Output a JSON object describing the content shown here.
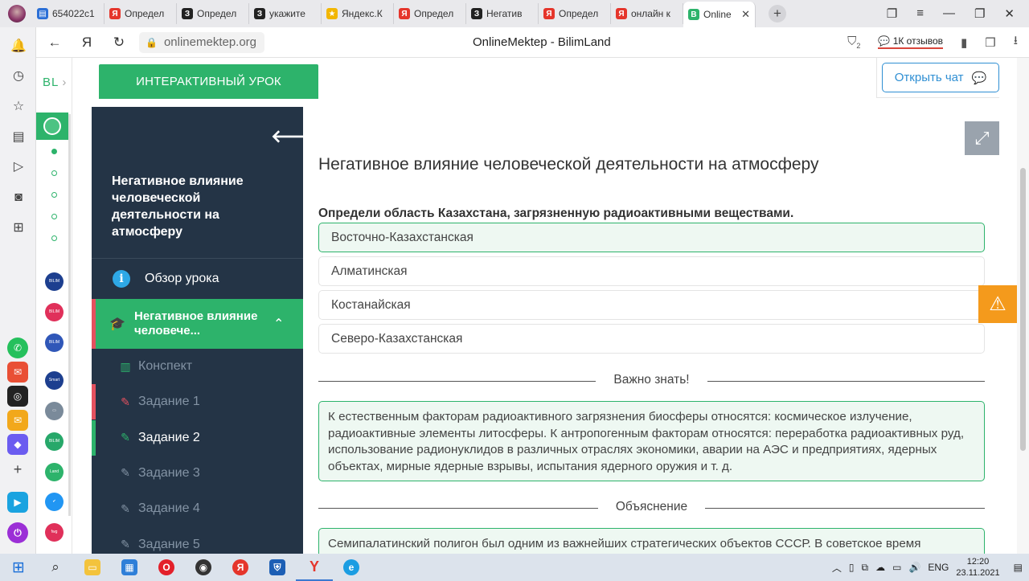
{
  "browser": {
    "tabs": [
      {
        "label": "654022c1",
        "fav": "doc",
        "color": "#2b6fd6"
      },
      {
        "label": "Определ",
        "fav": "Я",
        "color": "#e5352b"
      },
      {
        "label": "Определ",
        "fav": "З",
        "color": "#222222"
      },
      {
        "label": "укажите",
        "fav": "З",
        "color": "#222222"
      },
      {
        "label": "Яндекс.К",
        "fav": "★",
        "color": "#f2b600"
      },
      {
        "label": "Определ",
        "fav": "Я",
        "color": "#e5352b"
      },
      {
        "label": "Негатив",
        "fav": "З",
        "color": "#222222"
      },
      {
        "label": "Определ",
        "fav": "Я",
        "color": "#e5352b"
      },
      {
        "label": "онлайн к",
        "fav": "Я",
        "color": "#e5352b"
      },
      {
        "label": "Online",
        "fav": "B",
        "color": "#2db36b",
        "active": true
      }
    ],
    "url": "onlinemektep.org",
    "page_title": "OnlineMektep - BilimLand",
    "reviews": "1К отзывов",
    "downloads_badge": "2"
  },
  "site": {
    "logo": "BL",
    "interactive_lesson": "ИНТЕРАКТИВНЫЙ УРОК",
    "open_chat": "Открыть чат"
  },
  "panel": {
    "title": "Негативное влияние человеческой деятельности на атмосферу",
    "overview": "Обзор урока",
    "topic": "Негативное влияние человече...",
    "items": [
      {
        "label": "Конспект",
        "icon": "book-icon",
        "glyph": "▥",
        "mark": "",
        "current": false
      },
      {
        "label": "Задание 1",
        "icon": "edit-icon",
        "glyph": "✎",
        "mark": "#e4515f",
        "current": false
      },
      {
        "label": "Задание 2",
        "icon": "edit-icon",
        "glyph": "✎",
        "mark": "#2db36b",
        "current": true
      },
      {
        "label": "Задание 3",
        "icon": "edit-icon",
        "glyph": "✎",
        "mark": "",
        "current": false
      },
      {
        "label": "Задание 4",
        "icon": "edit-icon",
        "glyph": "✎",
        "mark": "",
        "current": false
      },
      {
        "label": "Задание 5",
        "icon": "edit-icon",
        "glyph": "✎",
        "mark": "",
        "current": false
      }
    ]
  },
  "lesson": {
    "heading": "Негативное влияние человеческой деятельности на атмосферу",
    "question": "Определи область Казахстана, загрязненную радиоактивными веществами.",
    "options": [
      {
        "label": "Восточно-Казахстанская",
        "correct": true
      },
      {
        "label": "Алматинская",
        "correct": false
      },
      {
        "label": "Костанайская",
        "correct": false
      },
      {
        "label": "Северо-Казахстанская",
        "correct": false
      }
    ],
    "important_label": "Важно знать!",
    "important_text": "К естественным факторам радиоактивного загрязнения биосферы относятся: космическое излучение, радиоактивные элементы литосферы. К антропогенным факторам относятся: переработка радиоактивных руд, использование радионуклидов в различных отраслях экономики, аварии на АЭС и предприятиях, ядерных объектах, мирные ядерные взрывы, испытания ядерного оружия и т. д.",
    "explanation_label": "Объяснение",
    "explanation_text": "Семипалатинский полигон был одним из важнейших стратегических объектов СССР. В советское время"
  },
  "taskbar": {
    "lang": "ENG",
    "time": "12:20",
    "date": "23.11.2021"
  }
}
